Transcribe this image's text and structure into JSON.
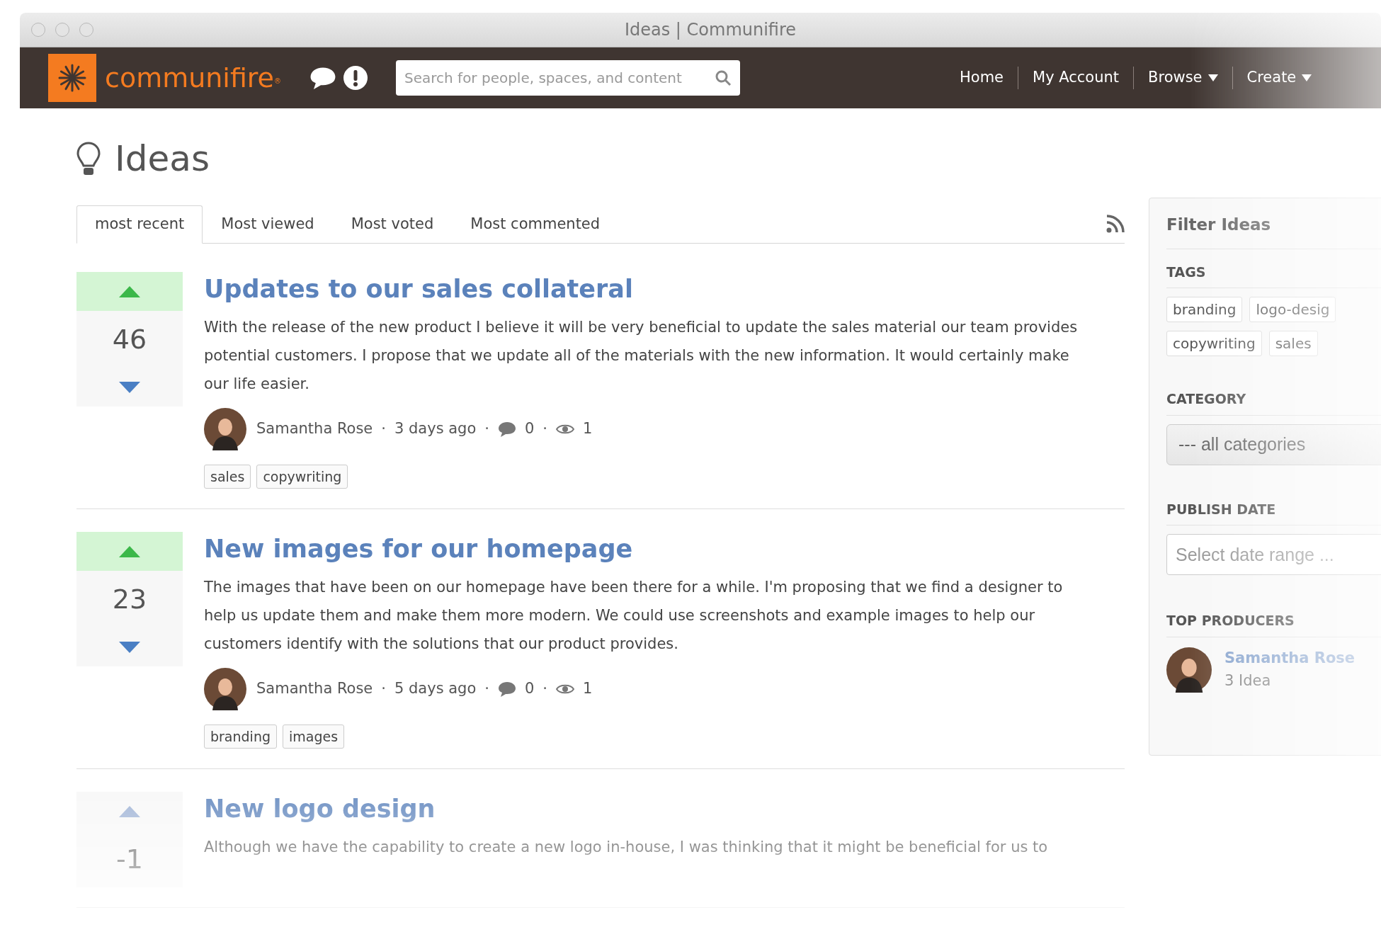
{
  "window": {
    "title": "Ideas | Communifire"
  },
  "nav": {
    "brand": "communifire",
    "brand_mark": "®",
    "search": {
      "placeholder": "Search for people, spaces, and content"
    },
    "links": [
      {
        "label": "Home",
        "dropdown": false
      },
      {
        "label": "My Account",
        "dropdown": false
      },
      {
        "label": "Browse",
        "dropdown": true
      },
      {
        "label": "Create",
        "dropdown": true
      }
    ]
  },
  "page": {
    "title": "Ideas",
    "separator": "·"
  },
  "tabs": [
    {
      "label": "most recent",
      "selected": true
    },
    {
      "label": "Most viewed",
      "selected": false
    },
    {
      "label": "Most voted",
      "selected": false
    },
    {
      "label": "Most commented",
      "selected": false
    }
  ],
  "ideas": [
    {
      "votes": "46",
      "upvoted": true,
      "title": "Updates to our sales collateral",
      "body": "With the release of the new product I believe it will be very beneficial to update the sales material our team provides potential customers. I propose that we update all of the materials with the new information. It would certainly make our life easier.",
      "author": "Samantha Rose",
      "time": "3 days ago",
      "comments": "0",
      "views": "1",
      "tags": [
        "sales",
        "copywriting"
      ]
    },
    {
      "votes": "23",
      "upvoted": true,
      "title": "New images for our homepage",
      "body": "The images that have been on our homepage have been there for a while. I'm proposing that we find a designer to help us update them and make them more modern. We could use screenshots and example images to help our customers identify with the solutions that our product provides.",
      "author": "Samantha Rose",
      "time": "5 days ago",
      "comments": "0",
      "views": "1",
      "tags": [
        "branding",
        "images"
      ]
    },
    {
      "votes": "-1",
      "upvoted": false,
      "title": "New logo design",
      "body": "Although we have the capability to create a new logo in-house, I was thinking that it might be beneficial for us to"
    }
  ],
  "sidebar": {
    "title": "Filter Ideas",
    "tags": {
      "heading": "TAGS",
      "items": [
        "branding",
        "logo-desig",
        "copywriting",
        "sales"
      ]
    },
    "category": {
      "heading": "CATEGORY",
      "value": "--- all categories"
    },
    "publish_date": {
      "heading": "PUBLISH DATE",
      "placeholder": "Select date range ..."
    },
    "top_producers": {
      "heading": "TOP PRODUCERS",
      "items": [
        {
          "name": "Samantha Rose",
          "count": "3 Idea"
        }
      ]
    }
  }
}
